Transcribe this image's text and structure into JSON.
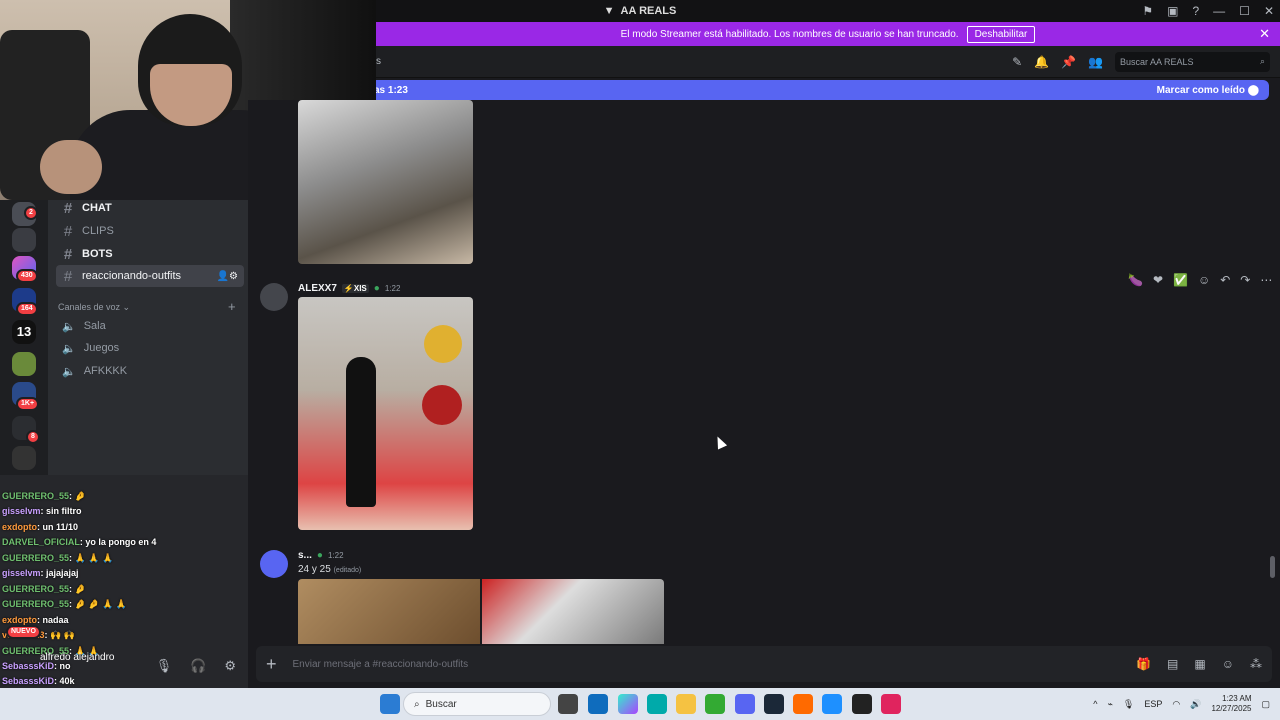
{
  "window": {
    "title": "AA REALS",
    "controls": [
      "flag-icon",
      "screen-icon",
      "help-icon",
      "minimize-icon",
      "maximize-icon",
      "close-icon"
    ]
  },
  "banner": {
    "text": "El modo Streamer está habilitado. Los nombres de usuario se han truncado.",
    "button_label": "Deshabilitar",
    "color": "#9a28e6"
  },
  "header": {
    "search_placeholder": "Buscar AA REALS",
    "fragment": "s"
  },
  "new_messages_bar": {
    "text": "as 1:23",
    "mark_read_label": "Marcar como leído",
    "color": "#5865f2"
  },
  "servers": {
    "badges": [
      "2",
      "430",
      "164",
      "1K+",
      "8"
    ],
    "label_13": "13"
  },
  "channels": {
    "items": [
      {
        "label": "CHAT"
      },
      {
        "label": "CLIPS"
      },
      {
        "label": "BOTS"
      },
      {
        "label": "reaccionando-outfits"
      }
    ],
    "voice_category": "Canales de voz",
    "voice_items": [
      "Sala",
      "Juegos",
      "AFKKKK"
    ]
  },
  "stream_chat": {
    "lines": [
      {
        "user": "GUERRERO_55",
        "text": ": 🤌"
      },
      {
        "user": "gisselvm",
        "text": ": sin filtro"
      },
      {
        "user": "exdopto",
        "text": ": un 11/10"
      },
      {
        "user": "DARVEL_OFICIAL",
        "text": ": yo la pongo en 4"
      },
      {
        "user": "GUERRERO_55",
        "text": ": 🙏 🙏 🙏"
      },
      {
        "user": "gisselvm",
        "text": ": jajajajaj"
      },
      {
        "user": "GUERRERO_55",
        "text": ": 🤌"
      },
      {
        "user": "GUERRERO_55",
        "text": ": 🤌 🤌 🙏 🙏"
      },
      {
        "user": "exdopto",
        "text": ": nadaa"
      },
      {
        "user": "ventran23",
        "text": ": 🙌 🙌"
      },
      {
        "user": "GUERRERO_55",
        "text": ": 🙏 🙏"
      },
      {
        "user": "SebasssKiD",
        "text": ": no"
      },
      {
        "user": "SebasssKiD",
        "text": ": 40k"
      }
    ],
    "nuevo_label": "NUEVO"
  },
  "user_panel": {
    "name": "alfredo alejandro"
  },
  "messages": [
    {
      "author": "ALEXX7",
      "tag": "XIS",
      "time": "1:22"
    },
    {
      "author": "s...",
      "time": "1:22",
      "text": "24 y 25",
      "edited": "(editado)"
    }
  ],
  "composer": {
    "placeholder": "Enviar mensaje a #reaccionando-outfits"
  },
  "taskbar": {
    "search_label": "Buscar",
    "lang": "ESP",
    "time": "1:23 AM",
    "date": "12/27/2025"
  }
}
